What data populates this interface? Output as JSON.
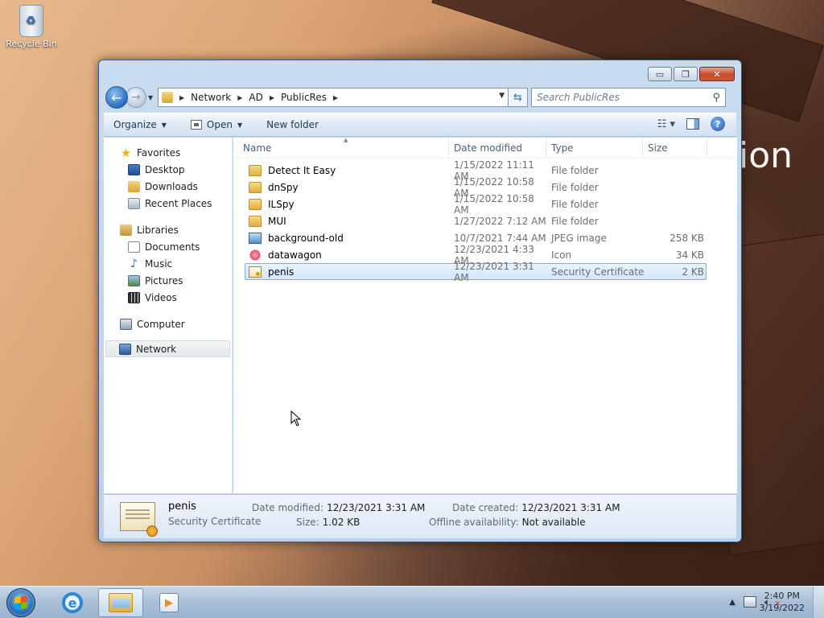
{
  "desktop": {
    "recycle_bin_label": "Recycle Bin",
    "wallpaper_text": "ion"
  },
  "window": {
    "caption_buttons": {
      "minimize": "▭",
      "maximize": "❐",
      "close": "✕"
    },
    "address": {
      "crumbs": [
        "Network",
        "AD",
        "PublicRes"
      ]
    },
    "search_placeholder": "Search PublicRes",
    "toolbar": {
      "organize": "Organize",
      "open": "Open",
      "new_folder": "New folder"
    },
    "nav": {
      "favorites": "Favorites",
      "desktop": "Desktop",
      "downloads": "Downloads",
      "recent_places": "Recent Places",
      "libraries": "Libraries",
      "documents": "Documents",
      "music": "Music",
      "pictures": "Pictures",
      "videos": "Videos",
      "computer": "Computer",
      "network": "Network"
    },
    "columns": {
      "name": "Name",
      "date_modified": "Date modified",
      "type": "Type",
      "size": "Size"
    },
    "files": [
      {
        "name": "Detect It Easy",
        "date": "1/15/2022 11:11 AM",
        "type": "File folder",
        "size": "",
        "icon": "folder-icon"
      },
      {
        "name": "dnSpy",
        "date": "1/15/2022 10:58 AM",
        "type": "File folder",
        "size": "",
        "icon": "folder-icon"
      },
      {
        "name": "ILSpy",
        "date": "1/15/2022 10:58 AM",
        "type": "File folder",
        "size": "",
        "icon": "folder-icon"
      },
      {
        "name": "MUI",
        "date": "1/27/2022 7:12 AM",
        "type": "File folder",
        "size": "",
        "icon": "folder-icon"
      },
      {
        "name": "background-old",
        "date": "10/7/2021 7:44 AM",
        "type": "JPEG image",
        "size": "258 KB",
        "icon": "image-file-icon"
      },
      {
        "name": "datawagon",
        "date": "12/23/2021 4:33 AM",
        "type": "Icon",
        "size": "34 KB",
        "icon": "icon-file-icon"
      },
      {
        "name": "penis",
        "date": "12/23/2021 3:31 AM",
        "type": "Security Certificate",
        "size": "2 KB",
        "icon": "certificate-file-icon"
      }
    ],
    "details": {
      "name": "penis",
      "type": "Security Certificate",
      "date_modified_label": "Date modified:",
      "date_modified": "12/23/2021 3:31 AM",
      "size_label": "Size:",
      "size": "1.02 KB",
      "date_created_label": "Date created:",
      "date_created": "12/23/2021 3:31 AM",
      "offline_label": "Offline availability:",
      "offline": "Not available"
    }
  },
  "taskbar": {
    "ie_letter": "e",
    "clock_time": "2:40 PM",
    "clock_date": "3/19/2022",
    "tray_arrow": "▲"
  }
}
